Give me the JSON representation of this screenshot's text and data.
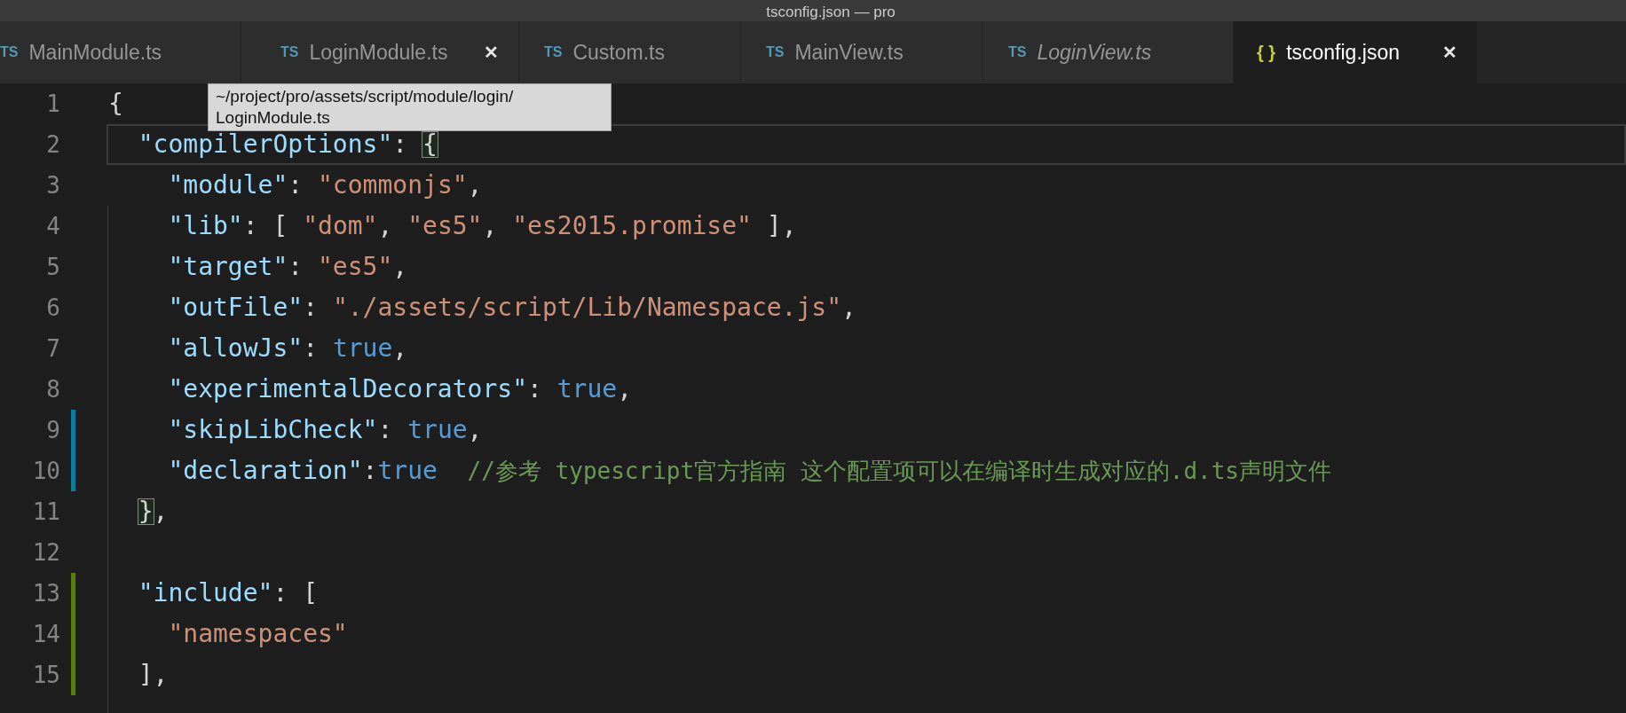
{
  "window": {
    "title": "tsconfig.json — pro"
  },
  "tabs": [
    {
      "kind": "ts",
      "icon": "TS",
      "label": "MainModule.ts",
      "selected": false,
      "italic": false,
      "close": false
    },
    {
      "kind": "ts",
      "icon": "TS",
      "label": "LoginModule.ts",
      "selected": false,
      "italic": false,
      "close": true
    },
    {
      "kind": "ts",
      "icon": "TS",
      "label": "Custom.ts",
      "selected": false,
      "italic": false,
      "close": false
    },
    {
      "kind": "ts",
      "icon": "TS",
      "label": "MainView.ts",
      "selected": false,
      "italic": false,
      "close": false
    },
    {
      "kind": "ts",
      "icon": "TS",
      "label": "LoginView.ts",
      "selected": false,
      "italic": true,
      "close": false
    },
    {
      "kind": "json",
      "icon": "{ }",
      "label": "tsconfig.json",
      "selected": true,
      "italic": false,
      "close": true
    }
  ],
  "close_glyph": "✕",
  "tooltip": {
    "lines": [
      "~/project/pro/assets/script/module/login/",
      "LoginModule.ts"
    ]
  },
  "editor": {
    "lines": [
      {
        "number": "1",
        "current": false,
        "tokens": [
          {
            "kind": "punct",
            "text": "{"
          }
        ]
      },
      {
        "number": "2",
        "current": true,
        "tokens": [
          {
            "kind": "key",
            "text": "  \"compilerOptions\""
          },
          {
            "kind": "punct",
            "text": ": "
          },
          {
            "kind": "punct",
            "text": "{",
            "matched": true
          }
        ]
      },
      {
        "number": "3",
        "current": false,
        "tokens": [
          {
            "kind": "key",
            "text": "    \"module\""
          },
          {
            "kind": "punct",
            "text": ": "
          },
          {
            "kind": "string",
            "text": "\"commonjs\""
          },
          {
            "kind": "punct",
            "text": ","
          }
        ]
      },
      {
        "number": "4",
        "current": false,
        "tokens": [
          {
            "kind": "key",
            "text": "    \"lib\""
          },
          {
            "kind": "punct",
            "text": ": [ "
          },
          {
            "kind": "string",
            "text": "\"dom\""
          },
          {
            "kind": "punct",
            "text": ", "
          },
          {
            "kind": "string",
            "text": "\"es5\""
          },
          {
            "kind": "punct",
            "text": ", "
          },
          {
            "kind": "string",
            "text": "\"es2015.promise\""
          },
          {
            "kind": "punct",
            "text": " ],"
          }
        ]
      },
      {
        "number": "5",
        "current": false,
        "tokens": [
          {
            "kind": "key",
            "text": "    \"target\""
          },
          {
            "kind": "punct",
            "text": ": "
          },
          {
            "kind": "string",
            "text": "\"es5\""
          },
          {
            "kind": "punct",
            "text": ","
          }
        ]
      },
      {
        "number": "6",
        "current": false,
        "tokens": [
          {
            "kind": "key",
            "text": "    \"outFile\""
          },
          {
            "kind": "punct",
            "text": ": "
          },
          {
            "kind": "string",
            "text": "\"./assets/script/Lib/Namespace.js\""
          },
          {
            "kind": "punct",
            "text": ","
          }
        ]
      },
      {
        "number": "7",
        "current": false,
        "tokens": [
          {
            "kind": "key",
            "text": "    \"allowJs\""
          },
          {
            "kind": "punct",
            "text": ": "
          },
          {
            "kind": "bool",
            "text": "true"
          },
          {
            "kind": "punct",
            "text": ","
          }
        ]
      },
      {
        "number": "8",
        "current": false,
        "tokens": [
          {
            "kind": "key",
            "text": "    \"experimentalDecorators\""
          },
          {
            "kind": "punct",
            "text": ": "
          },
          {
            "kind": "bool",
            "text": "true"
          },
          {
            "kind": "punct",
            "text": ","
          }
        ]
      },
      {
        "number": "9",
        "color": "#0c7d9d",
        "current": false,
        "tokens": [
          {
            "kind": "key",
            "text": "    \"skipLibCheck\""
          },
          {
            "kind": "punct",
            "text": ": "
          },
          {
            "kind": "bool",
            "text": "true"
          },
          {
            "kind": "punct",
            "text": ","
          }
        ]
      },
      {
        "number": "10",
        "color": "#0c7d9d",
        "current": false,
        "tokens": [
          {
            "kind": "key",
            "text": "    \"declaration\""
          },
          {
            "kind": "punct",
            "text": ":"
          },
          {
            "kind": "bool",
            "text": "true"
          },
          {
            "kind": "comment",
            "text": "  //参考 typescript官方指南 这个配置项可以在编译时生成对应的.d.ts声明文件"
          }
        ]
      },
      {
        "number": "11",
        "current": false,
        "tokens": [
          {
            "kind": "punct",
            "text": "  }",
            "matched": true
          },
          {
            "kind": "punct",
            "text": ","
          }
        ]
      },
      {
        "number": "12",
        "current": false
      },
      {
        "number": "13",
        "color": "#587c0c",
        "current": false,
        "tokens": [
          {
            "kind": "key",
            "text": "  \"include\""
          },
          {
            "kind": "punct",
            "text": ": ["
          }
        ]
      },
      {
        "number": "14",
        "color": "#587c0c",
        "current": false,
        "tokens": [
          {
            "kind": "string",
            "text": "    \"namespaces\""
          }
        ]
      },
      {
        "number": "15",
        "color": "#587c0c",
        "current": false,
        "tokens": [
          {
            "kind": "punct",
            "text": "  ],"
          }
        ]
      }
    ]
  }
}
